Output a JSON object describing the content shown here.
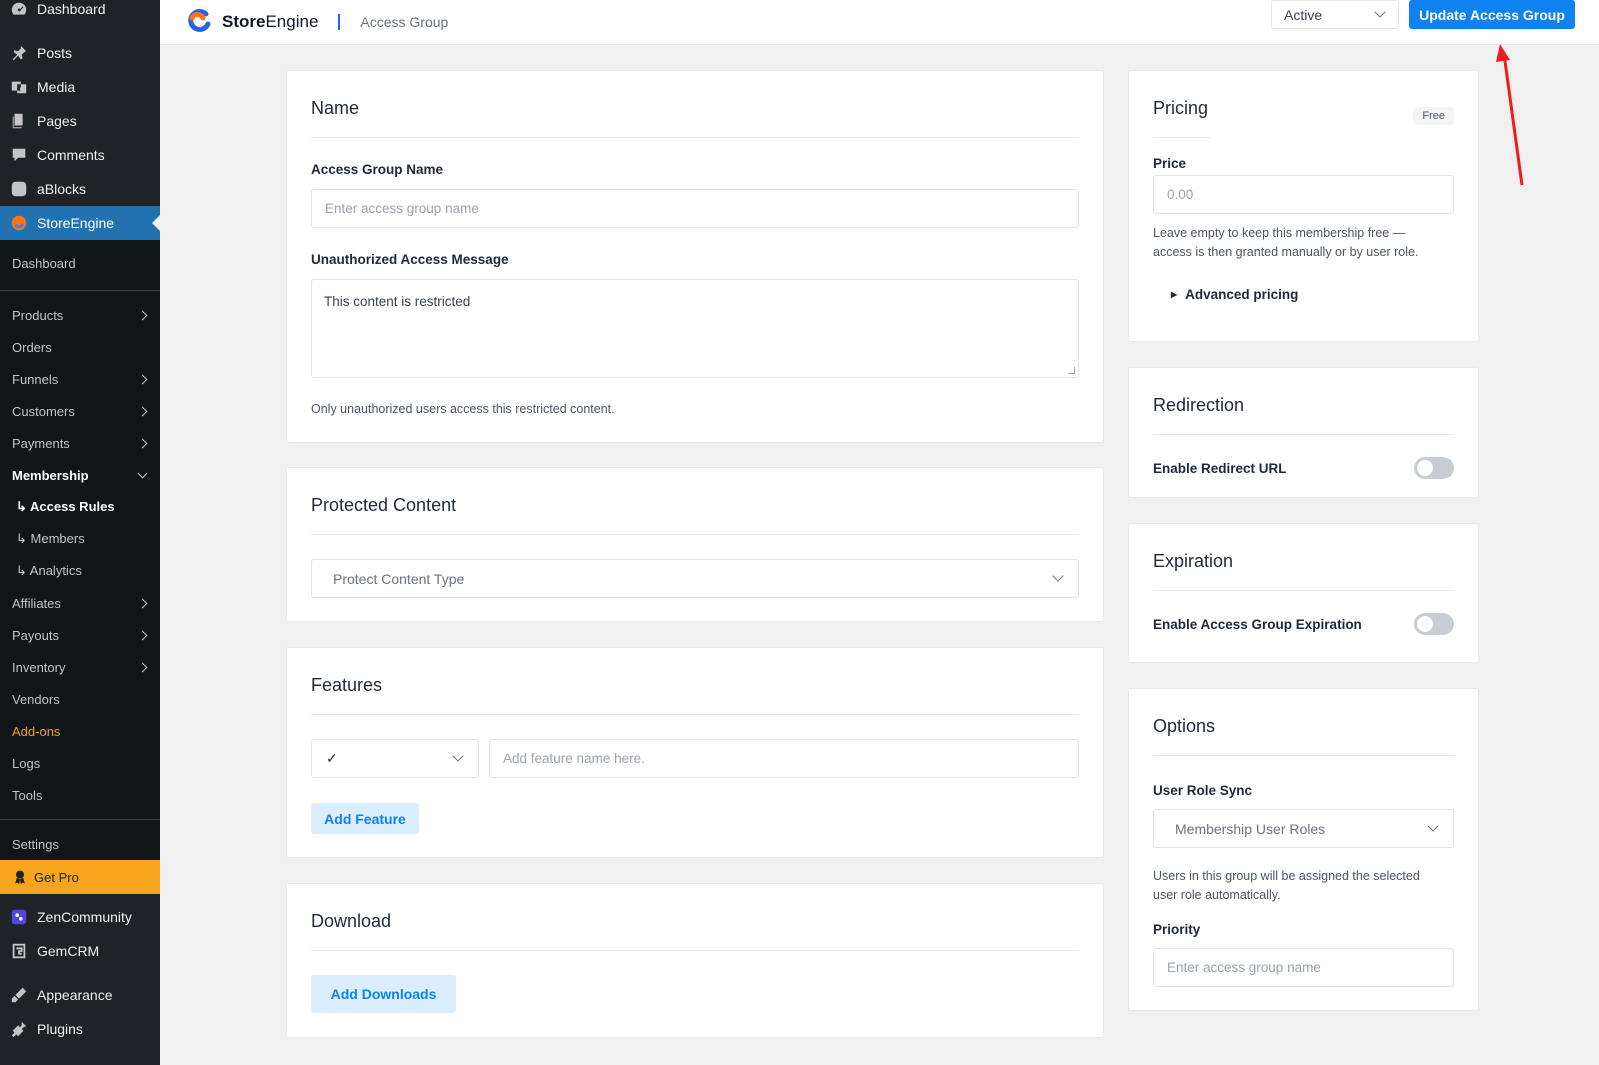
{
  "sidebar": {
    "top_items": [
      {
        "label": "Dashboard",
        "icon": "dashboard-icon"
      },
      {
        "label": "Posts",
        "icon": "pin-icon"
      },
      {
        "label": "Media",
        "icon": "media-icon"
      },
      {
        "label": "Pages",
        "icon": "pages-icon"
      },
      {
        "label": "Comments",
        "icon": "comments-icon"
      },
      {
        "label": "aBlocks",
        "icon": "ablocks-icon"
      },
      {
        "label": "StoreEngine",
        "icon": "storeengine-icon"
      }
    ],
    "sub_items": [
      {
        "label": "Dashboard"
      },
      {
        "label": "Products"
      },
      {
        "label": "Orders"
      },
      {
        "label": "Funnels"
      },
      {
        "label": "Customers"
      },
      {
        "label": "Payments"
      },
      {
        "label": "Membership"
      },
      {
        "label": "Access Rules"
      },
      {
        "label": "Members"
      },
      {
        "label": "Analytics"
      },
      {
        "label": "Affiliates"
      },
      {
        "label": "Payouts"
      },
      {
        "label": "Inventory"
      },
      {
        "label": "Vendors"
      },
      {
        "label": "Add-ons"
      },
      {
        "label": "Logs"
      },
      {
        "label": "Tools"
      },
      {
        "label": "Settings"
      },
      {
        "label": "Get Pro"
      }
    ],
    "bottom_items": [
      {
        "label": "ZenCommunity",
        "icon": "zencommunity-icon"
      },
      {
        "label": "GemCRM",
        "icon": "gemcrm-icon"
      },
      {
        "label": "Appearance",
        "icon": "appearance-icon"
      },
      {
        "label": "Plugins",
        "icon": "plugins-icon"
      }
    ],
    "accent_color": "#2271b1",
    "getpro_color": "#f7a51d"
  },
  "header": {
    "brand_bold": "Store",
    "brand_rest": "Engine",
    "breadcrumb": "Access Group",
    "status_value": "Active",
    "update_label": "Update Access Group",
    "update_color": "#0d82f0"
  },
  "name_card": {
    "title": "Name",
    "group_name_label": "Access Group Name",
    "group_name_placeholder": "Enter access group name",
    "message_label": "Unauthorized Access Message",
    "message_value": "This content is restricted",
    "help": "Only unauthorized users access this restricted content."
  },
  "protected_card": {
    "title": "Protected Content",
    "select_placeholder": "Protect Content Type"
  },
  "features_card": {
    "title": "Features",
    "icon_select_value": "✓",
    "feature_placeholder": "Add feature name here.",
    "add_button": "Add Feature"
  },
  "download_card": {
    "title": "Download",
    "add_button": "Add Downloads"
  },
  "pricing_card": {
    "title": "Pricing",
    "badge": "Free",
    "price_label": "Price",
    "price_placeholder": "0.00",
    "help_line1": "Leave empty to keep this membership free —",
    "help_line2": "access is then granted manually or by user role.",
    "advanced": "Advanced pricing"
  },
  "redirection_card": {
    "title": "Redirection",
    "toggle_label": "Enable Redirect URL",
    "toggle_on": false
  },
  "expiration_card": {
    "title": "Expiration",
    "toggle_label": "Enable Access Group Expiration",
    "toggle_on": false
  },
  "options_card": {
    "title": "Options",
    "role_sync_label": "User Role Sync",
    "role_sync_placeholder": "Membership User Roles",
    "help_line1": "Users in this group will be assigned the selected",
    "help_line2": "user role automatically.",
    "priority_label": "Priority",
    "priority_placeholder": "Enter access group name"
  }
}
